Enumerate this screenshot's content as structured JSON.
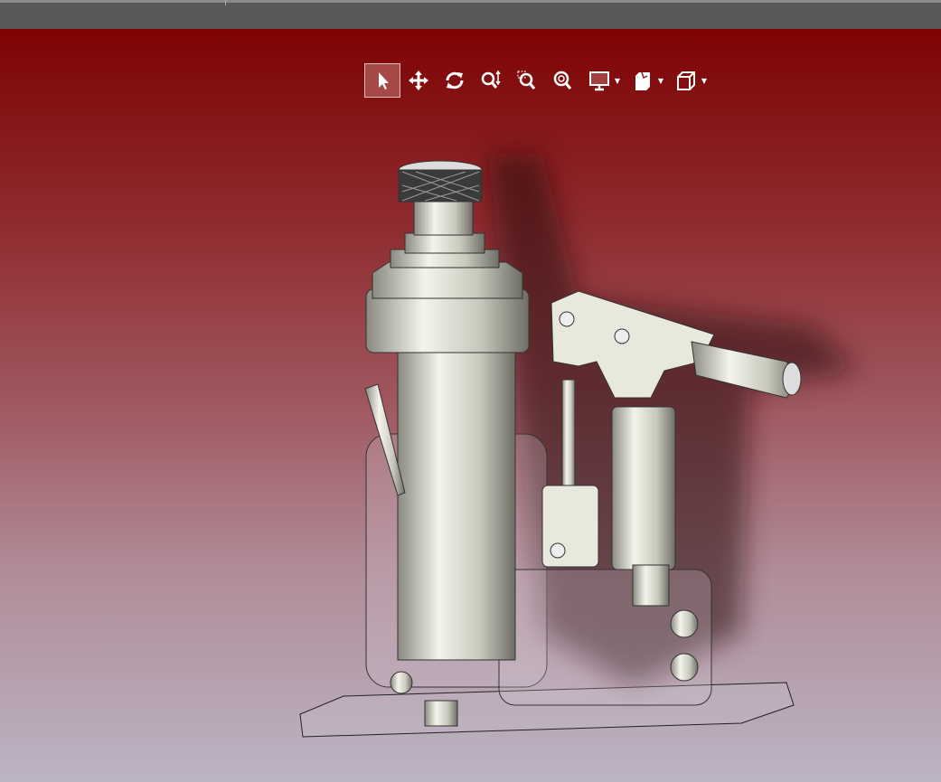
{
  "colors": {
    "toolbar_bg": "#595959",
    "viewport_top": "#7e0303",
    "viewport_bottom": "#bcb4c4",
    "active_tool": "#a54848"
  },
  "toolbar": {
    "tools": [
      {
        "name": "select",
        "icon": "cursor-arrow-icon",
        "active": true
      },
      {
        "name": "pan",
        "icon": "move-arrows-icon"
      },
      {
        "name": "rotate",
        "icon": "rotate-icon"
      },
      {
        "name": "zoom",
        "icon": "zoom-vertical-icon"
      },
      {
        "name": "zoom-window",
        "icon": "zoom-window-icon"
      },
      {
        "name": "zoom-fit",
        "icon": "zoom-fit-icon"
      },
      {
        "name": "display-style",
        "icon": "monitor-icon",
        "dropdown": true
      },
      {
        "name": "section-view",
        "icon": "section-icon",
        "dropdown": true
      },
      {
        "name": "standard-views",
        "icon": "cube-icon",
        "dropdown": true
      }
    ]
  }
}
